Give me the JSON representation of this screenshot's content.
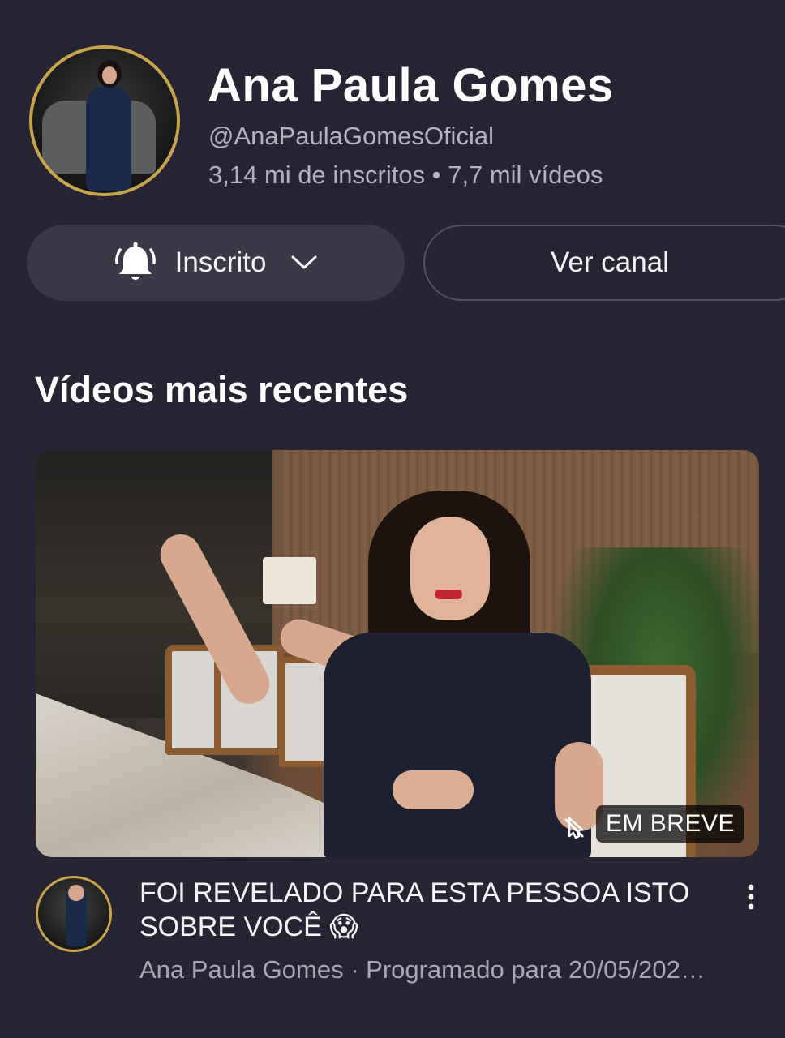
{
  "channel": {
    "name": "Ana Paula Gomes",
    "handle": "@AnaPaulaGomesOficial",
    "stats": "3,14 mi de inscritos • 7,7 mil vídeos"
  },
  "buttons": {
    "subscribed_label": "Inscrito",
    "view_channel_label": "Ver canal"
  },
  "section": {
    "title": "Vídeos mais recentes"
  },
  "video": {
    "title": "FOI REVELADO PARA ESTA PESSOA ISTO\nSOBRE VOCÊ 😱",
    "meta": "Ana Paula Gomes · Programado para 20/05/202…",
    "badge": "EM BREVE"
  },
  "icons": {
    "bell": "bell-icon",
    "chevron": "chevron-down-icon",
    "more": "more-vert-icon",
    "nocast": "cast-off-icon"
  },
  "colors": {
    "background": "#272534",
    "button_fill": "#3b3947",
    "avatar_ring": "#c8a44a",
    "secondary_text": "#b4b2bf"
  }
}
